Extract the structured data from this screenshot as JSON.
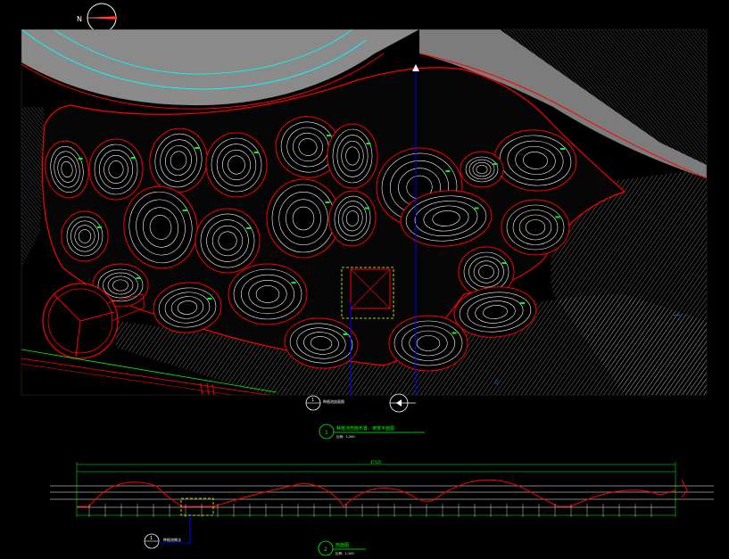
{
  "drawing": {
    "north_arrow": {
      "letter": "N"
    },
    "plan_view": {
      "section_marker_a": {
        "number": "1",
        "text": "种植池剖面图"
      },
      "section_marker_b": {
        "number": ""
      },
      "title_number": "1",
      "title_text": "种植池剖面布置、坡度平面图",
      "scale_text": "比例：1:200"
    },
    "section_view": {
      "title_number": "2",
      "title_text": "剖面图",
      "scale_text": "比例：1:100",
      "detail_marker": {
        "number": "1",
        "text": "种植池做法"
      },
      "total_dimension": "47125"
    }
  },
  "colors": {
    "background": "#000000",
    "contour": "#ffffff",
    "outline": "#ff0000",
    "label": "#00ff00",
    "paving": "#808080",
    "hatch": "#c8c8c8",
    "accent_blue": "#0000ff",
    "cyan": "#00ffff",
    "yellow": "#ffff00"
  }
}
